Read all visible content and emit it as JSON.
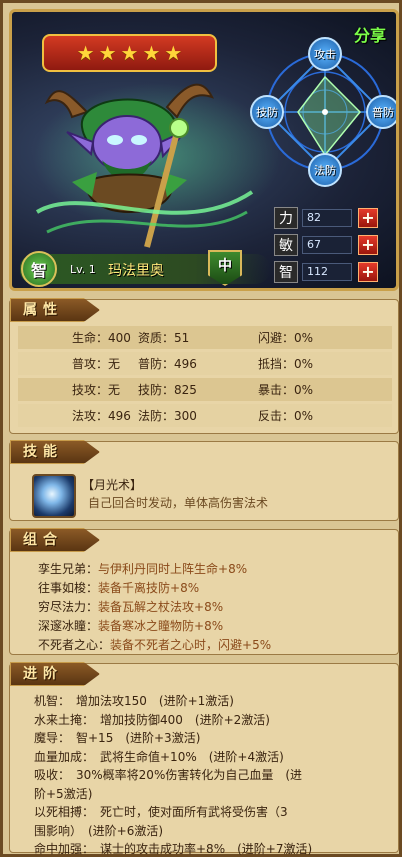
{
  "hero": {
    "stars": 5,
    "share_label": "分享",
    "level": "Lv. 1",
    "name": "玛法里奥",
    "type_badge": "智",
    "position_badge": "中",
    "radar": {
      "top": "攻击",
      "left": "技防",
      "right": "普防",
      "bottom": "法防"
    },
    "stats": [
      {
        "key": "力",
        "value": "82"
      },
      {
        "key": "敏",
        "value": "67"
      },
      {
        "key": "智",
        "value": "112"
      }
    ],
    "plus_label": "+"
  },
  "attributes": {
    "title": "属性",
    "rows": [
      [
        "生命：400",
        "资质：51",
        "闪避：0%"
      ],
      [
        "普攻：无",
        "普防：496",
        "抵挡：0%"
      ],
      [
        "技攻：无",
        "技防：825",
        "暴击：0%"
      ],
      [
        "法攻：496",
        "法防：300",
        "反击：0%"
      ]
    ]
  },
  "skill": {
    "title": "技能",
    "name": "【月光术】",
    "desc": "自己回合时发动，单体高伤害法术"
  },
  "combo": {
    "title": "组合",
    "items": [
      {
        "name": "孪生兄弟：",
        "desc": "与伊利丹同时上阵生命+8%"
      },
      {
        "name": "往事如梭：",
        "desc": "装备千离技防+8%"
      },
      {
        "name": "穷尽法力：",
        "desc": "装备瓦解之杖法攻+8%"
      },
      {
        "name": "深邃冰瞳：",
        "desc": "装备寒冰之瞳物防+8%"
      },
      {
        "name": "不死者之心：",
        "desc": "装备不死者之心时，闪避+5%"
      }
    ]
  },
  "advance": {
    "title": "进阶",
    "items": [
      "机智：　增加法攻150　(进阶+1激活)",
      "水来土掩：　增加技防御400　(进阶+2激活)",
      "魔导：　智+15　(进阶+3激活)",
      "血量加成：　武将生命值+10%　(进阶+4激活)",
      "吸收：　30%概率将20%伤害转化为自己血量　(进",
      "阶+5激活)",
      "以死相搏：　死亡时，使对面所有武将受伤害（3",
      "围影响）　(进阶+6激活)",
      "命中加强：　谋士的攻击成功率+8%　(进阶+7激活)"
    ]
  }
}
